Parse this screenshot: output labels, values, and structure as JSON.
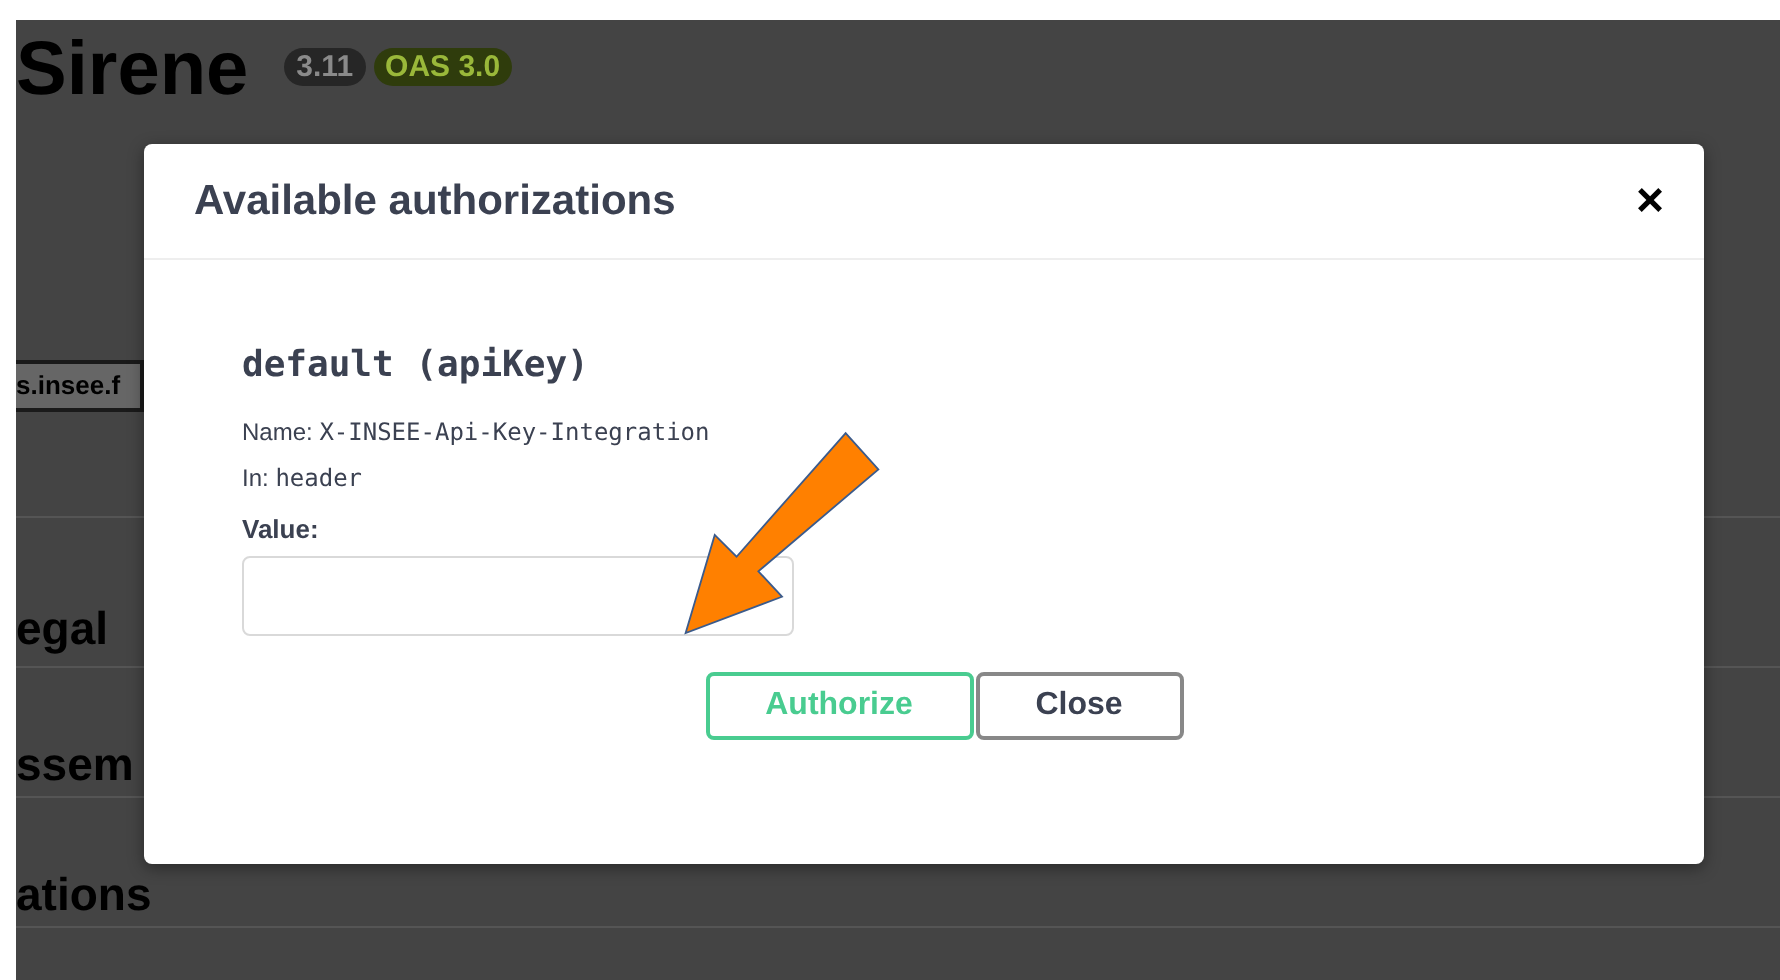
{
  "page": {
    "title": "Sirene",
    "version_badge": "3.11",
    "oas_badge": "OAS 3.0",
    "server": "s.insee.f",
    "sections": [
      "egal",
      "ssem",
      "ations"
    ]
  },
  "modal": {
    "title": "Available authorizations",
    "close_icon": "×",
    "scheme_title": "default (apiKey)",
    "name_label": "Name:",
    "name_value": "X-INSEE-Api-Key-Integration",
    "in_label": "In:",
    "in_value": "header",
    "value_label": "Value:",
    "buttons": [
      {
        "label": "Authorize",
        "kind": "primary"
      },
      {
        "label": "Close",
        "kind": "secondary"
      }
    ]
  }
}
